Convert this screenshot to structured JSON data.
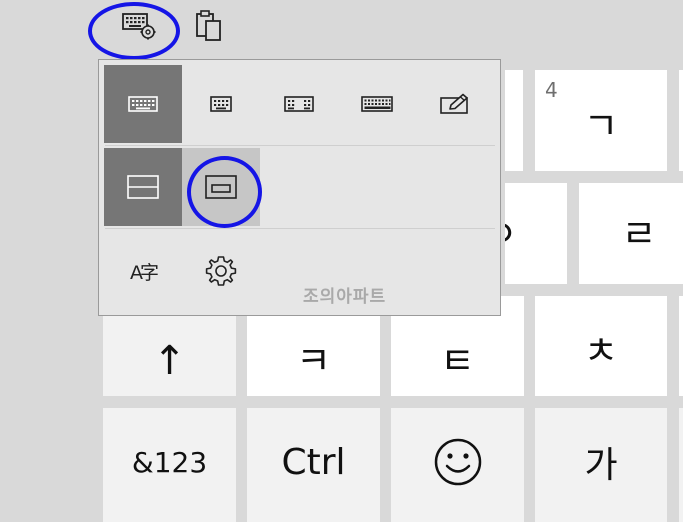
{
  "toolbar": {
    "items": [
      {
        "icon": "keyboard-settings-icon"
      },
      {
        "icon": "clipboard-icon"
      }
    ]
  },
  "keyboard": {
    "row1": [
      {
        "hint": "4",
        "label": "ㄱ"
      }
    ],
    "row2": [
      {
        "label": "ㅇ"
      },
      {
        "label": "ㄹ"
      }
    ],
    "row3": [
      {
        "label": "↑"
      },
      {
        "label": "ㅋ"
      },
      {
        "label": "ㅌ"
      },
      {
        "label": "ㅊ"
      }
    ],
    "row4": [
      {
        "label": "&123"
      },
      {
        "label": "Ctrl"
      },
      {
        "icon": "smiley-icon"
      },
      {
        "label": "가"
      }
    ]
  },
  "menu": {
    "layouts": [
      {
        "icon": "keyboard-default-icon",
        "selected": true
      },
      {
        "icon": "keyboard-small-icon",
        "selected": false
      },
      {
        "icon": "keyboard-split-icon",
        "selected": false
      },
      {
        "icon": "keyboard-full-icon",
        "selected": false
      },
      {
        "icon": "handwriting-pen-icon",
        "selected": false
      }
    ],
    "docking": [
      {
        "icon": "docked-keyboard-icon",
        "selected": true
      },
      {
        "icon": "floating-keyboard-icon",
        "selected": false,
        "hovered": true
      }
    ],
    "options": [
      {
        "icon": "language-icon",
        "label": "A字"
      },
      {
        "icon": "settings-gear-icon"
      }
    ],
    "watermark": "조의아파트"
  },
  "colors": {
    "background": "#d9d9d9",
    "key_white": "#ffffff",
    "key_grey": "#f2f2f2",
    "menu_bg": "#e6e6e6",
    "selected": "#767676",
    "hover": "#c6c6c6",
    "annotation": "#1515e6"
  }
}
